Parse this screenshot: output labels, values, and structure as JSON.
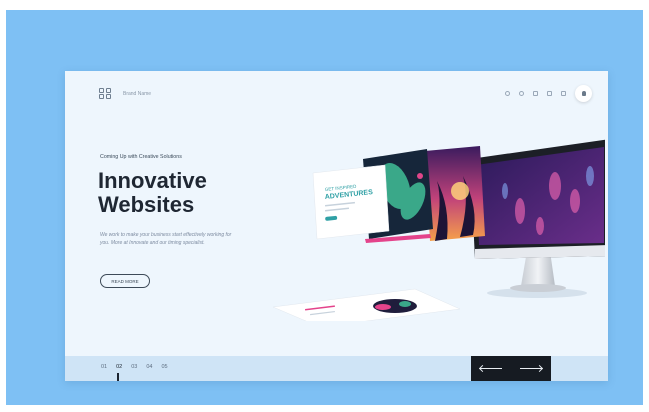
{
  "header": {
    "brand": "Brand Name",
    "nav_icons": [
      "search-icon",
      "phone-icon",
      "mail-icon",
      "cart-icon",
      "menu-icon",
      "user-icon"
    ]
  },
  "hero": {
    "tagline": "Coming Up with Creative Solutions",
    "headline_line1": "Innovative",
    "headline_line2": "Websites",
    "description": "We work to make your business start effectively working for you. More at Innovate and our timing specialist.",
    "button_label": "READ MORE"
  },
  "mockup": {
    "card_text_line1": "GET INSPIRED",
    "card_text_line2": "ADVENTURES"
  },
  "pager": {
    "pages": [
      "01",
      "02",
      "03",
      "04",
      "05"
    ],
    "active_index": 1
  },
  "colors": {
    "frame": "#7ec0f4",
    "page_bg": "#eef6fd",
    "accent_dark": "#161b22"
  }
}
